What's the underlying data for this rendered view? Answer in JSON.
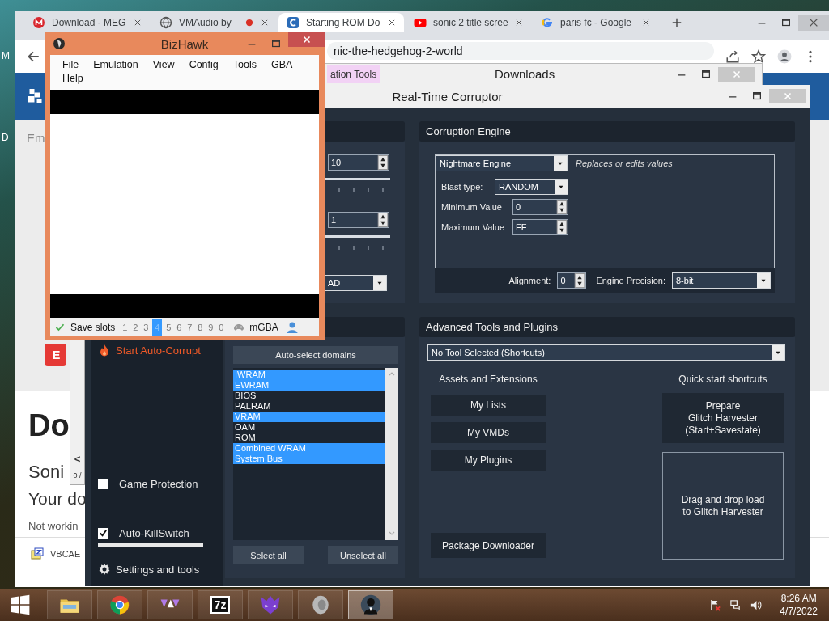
{
  "desktop_labels": [
    "M",
    "D"
  ],
  "browser": {
    "tabs": [
      {
        "title": "Download - MEG",
        "selected": false,
        "recording": false
      },
      {
        "title": "VMAudio by",
        "selected": false,
        "recording": true
      },
      {
        "title": "Starting ROM Do",
        "selected": true,
        "recording": false
      },
      {
        "title": "sonic 2 title scree",
        "selected": false,
        "recording": false
      },
      {
        "title": "paris fc - Google",
        "selected": false,
        "recording": false
      }
    ],
    "address": "nic-the-hedgehog-2-world",
    "page": {
      "field_text": "Em",
      "button_label": "E",
      "heading": "Do",
      "subtitle": "Soni",
      "lead": "Your do",
      "note": "Not workin",
      "file_name": "VBCAE"
    }
  },
  "background_window": {
    "arrow": "<",
    "counter": "0 /"
  },
  "downloads": {
    "title": "Downloads",
    "tab": "ation Tools"
  },
  "rtc": {
    "title": "Real-Time Corruptor",
    "sidebar": [
      {
        "kind": "action",
        "label": "Start Auto-Corrupt"
      },
      {
        "kind": "checkbox",
        "label": "Game Protection",
        "checked": false
      },
      {
        "kind": "checkbox",
        "label": "Auto-KillSwitch",
        "checked": true
      },
      {
        "kind": "link",
        "label": "Settings and tools"
      }
    ],
    "intensity": {
      "spinners": [
        {
          "value": "10"
        },
        {
          "value": "1"
        }
      ],
      "dropdown": "AD"
    },
    "domains": {
      "auto_select": "Auto-select domains",
      "items": [
        {
          "name": "IWRAM",
          "selected": true
        },
        {
          "name": "EWRAM",
          "selected": true
        },
        {
          "name": "BIOS",
          "selected": false
        },
        {
          "name": "PALRAM",
          "selected": false
        },
        {
          "name": "VRAM",
          "selected": true
        },
        {
          "name": "OAM",
          "selected": false
        },
        {
          "name": "ROM",
          "selected": false
        },
        {
          "name": "Combined WRAM",
          "selected": true
        },
        {
          "name": "System Bus",
          "selected": true
        }
      ],
      "select_all": "Select all",
      "unselect_all": "Unselect all"
    },
    "engine": {
      "heading": "Corruption Engine",
      "engine": "Nightmare Engine",
      "description": "Replaces or edits values",
      "fields": [
        {
          "kind": "select",
          "label": "Blast type:",
          "value": "RANDOM"
        },
        {
          "kind": "spin",
          "label": "Minimum Value",
          "value": "0"
        },
        {
          "kind": "spin",
          "label": "Maximum Value",
          "value": "FF"
        }
      ],
      "alignment": {
        "label": "Alignment:",
        "value": "0"
      },
      "precision": {
        "label": "Engine Precision:",
        "value": "8-bit"
      }
    },
    "advanced": {
      "heading": "Advanced Tools and Plugins",
      "tool": "No Tool Selected (Shortcuts)",
      "assets_heading": "Assets and Extensions",
      "assets": [
        "My Lists",
        "My VMDs",
        "My Plugins"
      ],
      "package_button": "Package Downloader",
      "shortcuts_heading": "Quick start shortcuts",
      "prepare_button": "Prepare\nGlitch Harvester\n(Start+Savestate)",
      "drop_zone": "Drag and drop load\nto Glitch Harvester"
    }
  },
  "bizhawk": {
    "title": "BizHawk",
    "menu": [
      "File",
      "Emulation",
      "View",
      "Config",
      "Tools",
      "GBA",
      "Help"
    ],
    "status": {
      "label": "Save slots",
      "slots": [
        {
          "label": "1",
          "selected": false
        },
        {
          "label": "2",
          "selected": false
        },
        {
          "label": "3",
          "selected": false
        },
        {
          "label": "4",
          "selected": true
        },
        {
          "label": "5",
          "selected": false
        },
        {
          "label": "6",
          "selected": false
        },
        {
          "label": "7",
          "selected": false
        },
        {
          "label": "8",
          "selected": false
        },
        {
          "label": "9",
          "selected": false
        },
        {
          "label": "0",
          "selected": false
        }
      ],
      "core": "mGBA"
    }
  },
  "taskbar": {
    "apps": [
      {
        "active": false
      },
      {
        "active": false
      },
      {
        "active": false
      },
      {
        "active": false,
        "label": "7z"
      },
      {
        "active": false
      },
      {
        "active": false
      },
      {
        "active": true
      }
    ],
    "time": "8:26 AM",
    "date": "4/7/2022"
  }
}
